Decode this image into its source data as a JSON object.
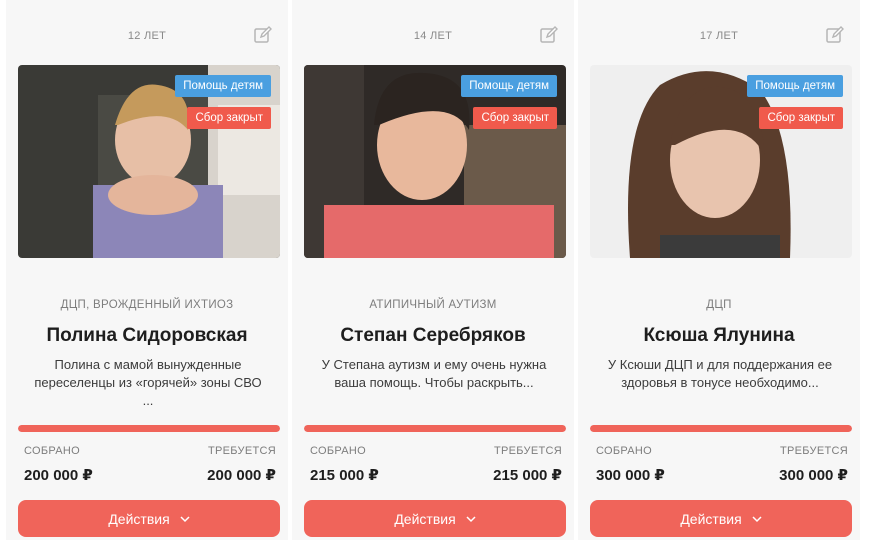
{
  "colors": {
    "accent": "#f0645a",
    "tag_help": "#4a9fe0",
    "tag_closed": "#f05a4c"
  },
  "cards": [
    {
      "age": "12 ЛЕТ",
      "tag_help": "Помощь детям",
      "tag_closed": "Сбор закрыт",
      "diagnosis": "ДЦП, ВРОЖДЕННЫЙ ИХТИОЗ",
      "name": "Полина Сидоровская",
      "description": "Полина с мамой вынужденные\nпереселенцы из «горячей» зоны СВО ...",
      "collected_label": "СОБРАНО",
      "required_label": "ТРЕБУЕТСЯ",
      "collected": "200 000 ₽",
      "required": "200 000 ₽",
      "progress": 1.0,
      "button": "Действия",
      "edit_icon": "edit-icon",
      "chevron_icon": "chevron-down-icon"
    },
    {
      "age": "14 ЛЕТ",
      "tag_help": "Помощь детям",
      "tag_closed": "Сбор закрыт",
      "diagnosis": "АТИПИЧНЫЙ АУТИЗМ",
      "name": "Степан Серебряков",
      "description": "У Степана аутизм и ему очень нужна\nваша помощь. Чтобы раскрыть...",
      "collected_label": "СОБРАНО",
      "required_label": "ТРЕБУЕТСЯ",
      "collected": "215 000 ₽",
      "required": "215 000 ₽",
      "progress": 1.0,
      "button": "Действия",
      "edit_icon": "edit-icon",
      "chevron_icon": "chevron-down-icon"
    },
    {
      "age": "17 ЛЕТ",
      "tag_help": "Помощь детям",
      "tag_closed": "Сбор закрыт",
      "diagnosis": "ДЦП",
      "name": "Ксюша Ялунина",
      "description": "У Ксюши ДЦП и для поддержания ее\nздоровья в тонусе необходимо...",
      "collected_label": "СОБРАНО",
      "required_label": "ТРЕБУЕТСЯ",
      "collected": "300 000 ₽",
      "required": "300 000 ₽",
      "progress": 1.0,
      "button": "Действия",
      "edit_icon": "edit-icon",
      "chevron_icon": "chevron-down-icon"
    }
  ]
}
